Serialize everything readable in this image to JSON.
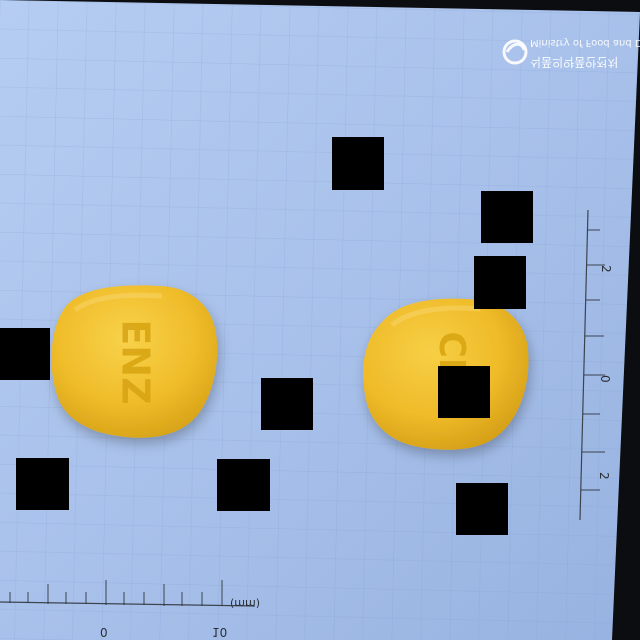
{
  "photo": {
    "colors": {
      "background": "#a7c0ea",
      "grid": "#7f9bd0",
      "pill": "#f2bf2d",
      "pill_shadow": "#d19d13",
      "ruler": "#2b2f36",
      "logo": "#ffffff",
      "mask": "#000000",
      "corner_dark": "#0b0d10"
    },
    "watermark": {
      "line1": "Ministry of Food and Drug Safety",
      "line2": "식품의약품안전처",
      "icon": "mfds-logo-icon"
    },
    "pills": [
      {
        "imprint": "ENZ"
      },
      {
        "imprint": "CFN"
      }
    ],
    "ruler_bottom": {
      "labels": [
        "0",
        "10"
      ],
      "unit": "(mm)"
    },
    "ruler_right": {
      "labels": [
        "2",
        "0",
        "2"
      ]
    }
  }
}
